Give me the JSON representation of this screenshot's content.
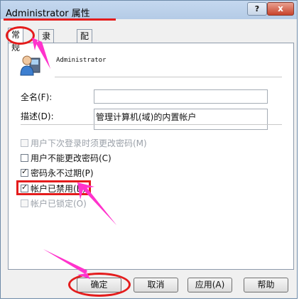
{
  "window": {
    "title": "Administrator 属性",
    "help_label": "?",
    "close_label": "x"
  },
  "tabs": [
    {
      "label": "常规",
      "active": true
    },
    {
      "label": "隶属于",
      "active": false
    },
    {
      "label": "配置文件",
      "active": false
    }
  ],
  "user": {
    "name": "Administrator"
  },
  "fields": {
    "fullname_label": "全名(F):",
    "fullname_value": "",
    "description_label": "描述(D):",
    "description_value": "管理计算机(域)的内置帐户"
  },
  "options": [
    {
      "label": "用户下次登录时须更改密码(M)",
      "checked": false,
      "disabled": true
    },
    {
      "label": "用户不能更改密码(C)",
      "checked": false,
      "disabled": false
    },
    {
      "label": "密码永不过期(P)",
      "checked": true,
      "disabled": false
    },
    {
      "label": "帐户已禁用(B)",
      "checked": true,
      "disabled": false
    },
    {
      "label": "帐户已锁定(O)",
      "checked": false,
      "disabled": true
    }
  ],
  "buttons": {
    "ok": "确定",
    "cancel": "取消",
    "apply": "应用(A)",
    "help": "帮助"
  },
  "colors": {
    "annotation_red": "#e41c1c",
    "annotation_arrow": "#ff33cc"
  }
}
